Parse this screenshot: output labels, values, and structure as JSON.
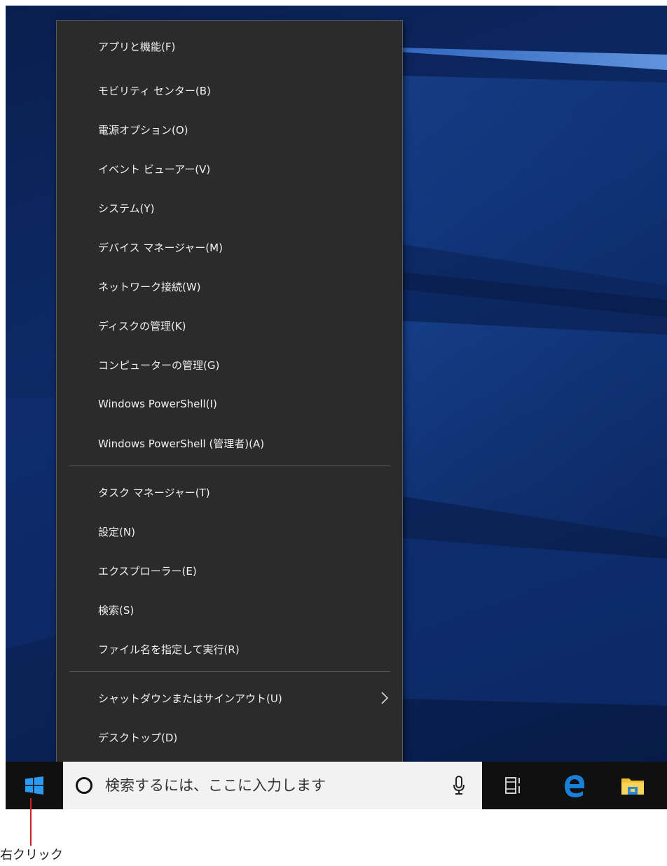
{
  "context_menu": {
    "group1": [
      {
        "label": "アプリと機能(F)"
      },
      {
        "label": "モビリティ センター(B)"
      },
      {
        "label": "電源オプション(O)"
      },
      {
        "label": "イベント ビューアー(V)"
      },
      {
        "label": "システム(Y)"
      },
      {
        "label": "デバイス マネージャー(M)"
      },
      {
        "label": "ネットワーク接続(W)"
      },
      {
        "label": "ディスクの管理(K)"
      },
      {
        "label": "コンピューターの管理(G)"
      },
      {
        "label": "Windows PowerShell(I)"
      },
      {
        "label": "Windows PowerShell (管理者)(A)"
      }
    ],
    "group2": [
      {
        "label": "タスク マネージャー(T)"
      },
      {
        "label": "設定(N)"
      },
      {
        "label": "エクスプローラー(E)"
      },
      {
        "label": "検索(S)"
      },
      {
        "label": "ファイル名を指定して実行(R)"
      }
    ],
    "group3": [
      {
        "label": "シャットダウンまたはサインアウト(U)",
        "has_submenu": true
      },
      {
        "label": "デスクトップ(D)"
      }
    ]
  },
  "taskbar": {
    "search_placeholder": "検索するには、ここに入力します",
    "icons": [
      "windows-start-icon",
      "search-circle-icon",
      "microphone-icon",
      "task-view-icon",
      "edge-icon",
      "file-explorer-icon"
    ]
  },
  "annotation": {
    "label": "右クリック",
    "color": "#d0202a"
  },
  "colors": {
    "menu_bg": "#2b2b2b",
    "menu_text": "#f0f0f0",
    "taskbar_bg": "#101010",
    "search_bg": "#f2f2f2",
    "accent": "#1e88e5"
  }
}
